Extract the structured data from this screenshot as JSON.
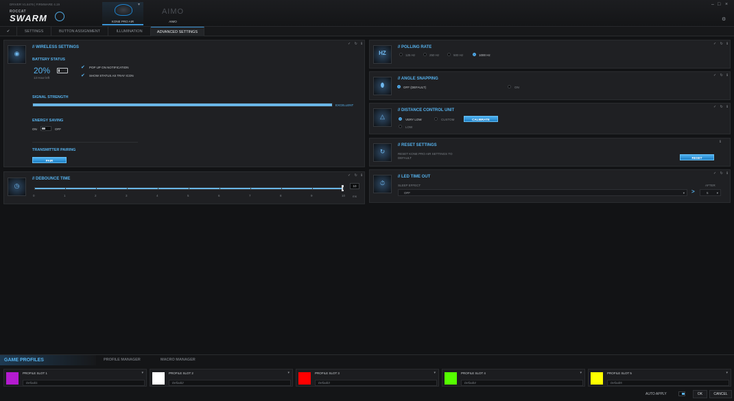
{
  "app": {
    "version": "DRIVER V1.8476 | FIRMWARE 4.19",
    "brand_small": "ROCCAT",
    "brand": "SWARM"
  },
  "devices": [
    {
      "name": "KONE PRO AIR",
      "active": true
    },
    {
      "name": "AIMO",
      "logo": "AIMO",
      "active": false
    }
  ],
  "window_controls": {
    "minimize": "–",
    "maximize": "□",
    "close": "×",
    "settings": "⚙"
  },
  "tabs": [
    "SETTINGS",
    "BUTTON ASSIGNMENT",
    "ILLUMINATION",
    "ADVANCED SETTINGS"
  ],
  "tab_icon": "pin-icon",
  "panel_controls": "✓ ↻ ℹ",
  "wireless": {
    "title": "// WIRELESS SETTINGS",
    "icon": "wifi-icon",
    "battery_label": "BATTERY STATUS",
    "battery_value": "20%",
    "battery_time": "13 Hour left",
    "battery_level": 0.2,
    "popup_label": "POP UP ON NOTIFICATION",
    "tray_label": "SHOW STATUS AS TRAY ICON",
    "signal_label": "SIGNAL STRENGTH",
    "signal_value": "EXCELLENT",
    "signal_level": 1.0,
    "energy_label": "ENERGY SAVING",
    "energy_on": "ON",
    "energy_off": "OFF",
    "pairing_label": "TRANSMITTER PAIRING",
    "pair_button": "PAIR"
  },
  "debounce": {
    "title": "// DEBOUNCE TIME",
    "icon": "timer-icon",
    "ticks": [
      "0",
      "1",
      "2",
      "3",
      "4",
      "5",
      "6",
      "7",
      "8",
      "9",
      "10"
    ],
    "value": "10",
    "unit": "ms",
    "level": 1.0
  },
  "polling": {
    "title": "// POLLING RATE",
    "icon": "hz-icon",
    "icon_text": "HZ",
    "options": [
      "125 Hz",
      "250 Hz",
      "500 Hz",
      "1000 Hz"
    ],
    "selected": "1000 Hz"
  },
  "angle": {
    "title": "// ANGLE SNAPPING",
    "icon": "mouse-icon",
    "off_label": "OFF (DEFAULT)",
    "on_label": "ON",
    "selected": "OFF (DEFAULT)"
  },
  "distance": {
    "title": "// DISTANCE CONTROL UNIT",
    "icon": "distance-icon",
    "very_low": "VERY LOW",
    "custom": "CUSTOM",
    "low": "LOW",
    "selected": "VERY LOW",
    "calibrate_button": "CALIBRATE"
  },
  "reset": {
    "title": "// RESET SETTINGS",
    "icon": "reset-icon",
    "description_1": "RESET KONE PRO AIR SETTINGS TO",
    "description_2": "DEFAULT",
    "button": "RESET"
  },
  "led": {
    "title": "// LED TIME OUT",
    "icon": "stopwatch-icon",
    "sleep_label": "SLEEP EFFECT",
    "sleep_value": "OFF",
    "arrow": ">",
    "after_label": "AFTER",
    "after_value": "5"
  },
  "bottom": {
    "tabs": [
      "GAME PROFILES",
      "PROFILE MANAGER",
      "MACRO MANAGER"
    ],
    "profiles": [
      {
        "name": "PROFILE SLOT 1",
        "sub": "Default1",
        "color": "#b41bd0"
      },
      {
        "name": "PROFILE SLOT 2",
        "sub": "Default2",
        "color": "#ffffff"
      },
      {
        "name": "PROFILE SLOT 3",
        "sub": "Default3",
        "color": "#ff0000"
      },
      {
        "name": "PROFILE SLOT 4",
        "sub": "Default4",
        "color": "#55ff00"
      },
      {
        "name": "PROFILE SLOT 5",
        "sub": "Default5",
        "color": "#ffff00"
      }
    ],
    "auto_apply": "AUTO APPLY",
    "ok": "OK",
    "cancel": "CANCEL"
  },
  "colors": {
    "accent": "#3a93d4",
    "title": "#56b2ee",
    "panel": "#1f2023"
  }
}
